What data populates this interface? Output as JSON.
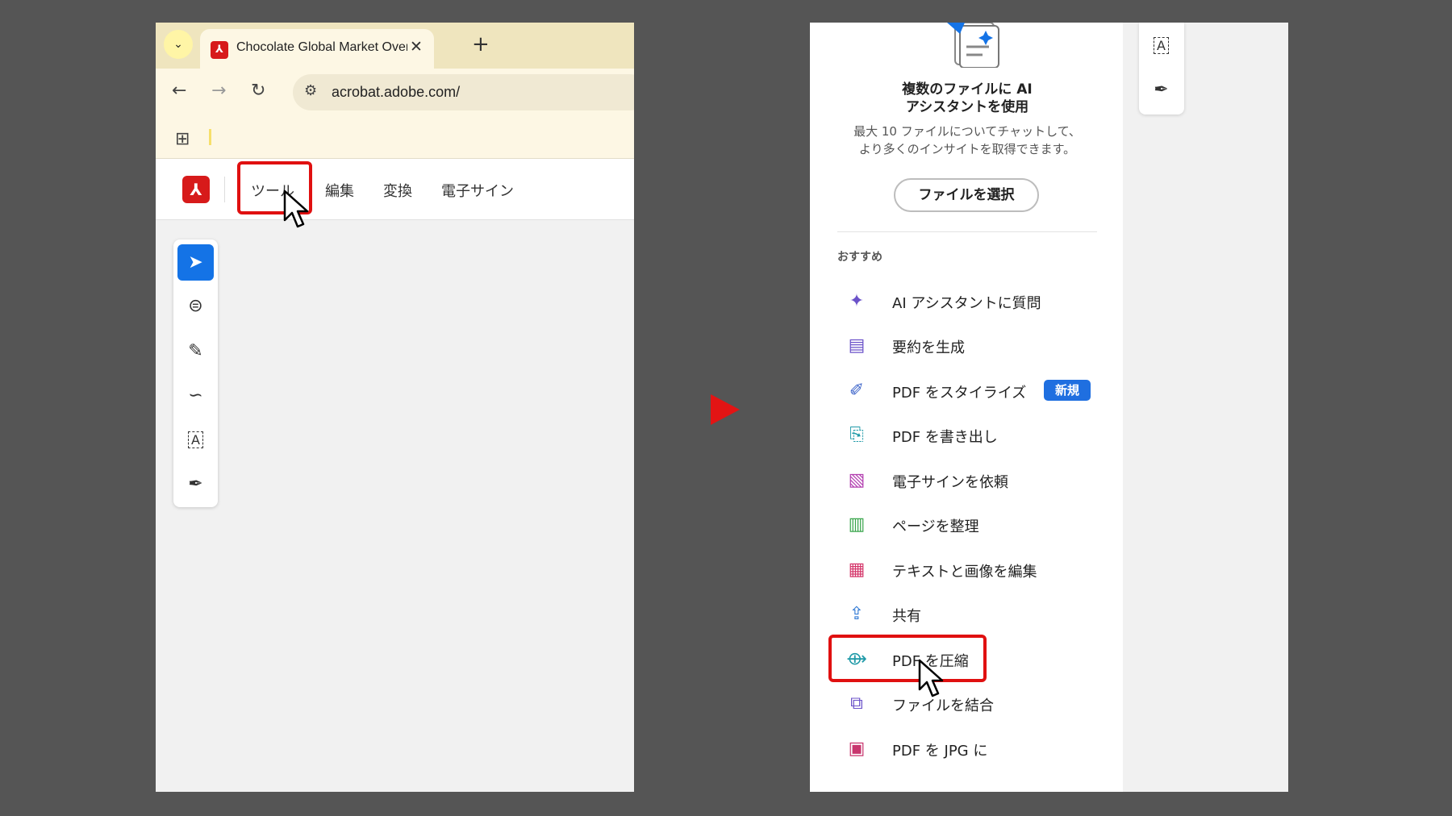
{
  "left_panel": {
    "browser": {
      "tab_title": "Chocolate Global Market Overv",
      "tab_close": "✕",
      "new_tab": "+",
      "dropdown": "⌄",
      "back": "←",
      "forward": "→",
      "reload": "↻",
      "url": "acrobat.adobe.com/",
      "apps_icon": "⊞"
    },
    "acrobat": {
      "menu": [
        "ツール",
        "編集",
        "変換",
        "電子サイン"
      ]
    },
    "tools": [
      "select-icon",
      "comment-icon",
      "highlight-pen-icon",
      "draw-icon",
      "text-select-icon",
      "sign-icon"
    ]
  },
  "right_panel": {
    "heading": "複数のファイルに AI アシスタントを使用",
    "heading_line1": "複数のファイルに AI",
    "heading_line2": "アシスタントを使用",
    "subtext_line1": "最大 10 ファイルについてチャットして、",
    "subtext_line2": "より多くのインサイトを取得できます。",
    "select_button": "ファイルを選択",
    "section_label": "おすすめ",
    "items": [
      {
        "label": "AI アシスタントに質問",
        "icon": "ai-chat-icon",
        "color": "#6b52c9"
      },
      {
        "label": "要約を生成",
        "icon": "summary-icon",
        "color": "#6b52c9"
      },
      {
        "label": "PDF をスタイライズ",
        "icon": "stylize-icon",
        "color": "#3b63c9",
        "badge": "新規"
      },
      {
        "label": "PDF を書き出し",
        "icon": "export-pdf-icon",
        "color": "#1f9aa8"
      },
      {
        "label": "電子サインを依頼",
        "icon": "request-esign-icon",
        "color": "#b33fb0"
      },
      {
        "label": "ページを整理",
        "icon": "organize-pages-icon",
        "color": "#3aa54c"
      },
      {
        "label": "テキストと画像を編集",
        "icon": "edit-text-image-icon",
        "color": "#d5376b"
      },
      {
        "label": "共有",
        "icon": "share-icon",
        "color": "#2f78d4"
      },
      {
        "label": "PDF を圧縮",
        "icon": "compress-pdf-icon",
        "color": "#1f9aa8"
      },
      {
        "label": "ファイルを結合",
        "icon": "combine-files-icon",
        "color": "#6b52c9"
      },
      {
        "label": "PDF を JPG に",
        "icon": "pdf-to-jpg-icon",
        "color": "#c8366e"
      }
    ]
  },
  "colors": {
    "highlight": "#e01010",
    "accent_blue": "#1473e6",
    "arrow": "#e31414"
  }
}
